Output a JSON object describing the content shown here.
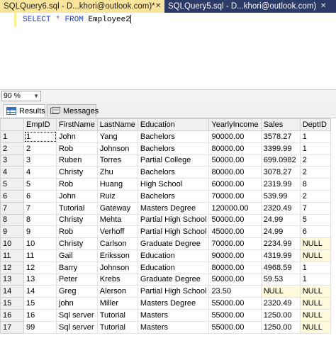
{
  "tabs": [
    {
      "title": "SQLQuery6.sql - D...khori@outlook.com)*",
      "close": "✕"
    },
    {
      "title": "SQLQuery5.sql - D...khori@outlook.com)",
      "close": "✕"
    }
  ],
  "editor": {
    "keyword_select": "SELECT",
    "star": "*",
    "keyword_from": "FROM",
    "table": "Employee2"
  },
  "zoom": {
    "value": "90 %"
  },
  "results_tabs": [
    {
      "label": "Results",
      "icon": "grid-icon"
    },
    {
      "label": "Messages",
      "icon": "messages-icon"
    }
  ],
  "grid": {
    "columns": [
      "EmpID",
      "FirstName",
      "LastName",
      "Education",
      "YearlyIncome",
      "Sales",
      "DeptID"
    ],
    "rows": [
      [
        "1",
        "1",
        "John",
        "Yang",
        "Bachelors",
        "90000.00",
        "3578.27",
        "1"
      ],
      [
        "2",
        "2",
        "Rob",
        "Johnson",
        "Bachelors",
        "80000.00",
        "3399.99",
        "1"
      ],
      [
        "3",
        "3",
        "Ruben",
        "Torres",
        "Partial College",
        "50000.00",
        "699.0982",
        "2"
      ],
      [
        "4",
        "4",
        "Christy",
        "Zhu",
        "Bachelors",
        "80000.00",
        "3078.27",
        "2"
      ],
      [
        "5",
        "5",
        "Rob",
        "Huang",
        "High School",
        "60000.00",
        "2319.99",
        "8"
      ],
      [
        "6",
        "6",
        "John",
        "Ruiz",
        "Bachelors",
        "70000.00",
        "539.99",
        "2"
      ],
      [
        "7",
        "7",
        "Tutorial",
        "Gateway",
        "Masters Degree",
        "120000.00",
        "2320.49",
        "7"
      ],
      [
        "8",
        "8",
        "Christy",
        "Mehta",
        "Partial High School",
        "50000.00",
        "24.99",
        "5"
      ],
      [
        "9",
        "9",
        "Rob",
        "Verhoff",
        "Partial High School",
        "45000.00",
        "24.99",
        "6"
      ],
      [
        "10",
        "10",
        "Christy",
        "Carlson",
        "Graduate Degree",
        "70000.00",
        "2234.99",
        "NULL"
      ],
      [
        "11",
        "11",
        "Gail",
        "Eriksson",
        "Education",
        "90000.00",
        "4319.99",
        "NULL"
      ],
      [
        "12",
        "12",
        "Barry",
        "Johnson",
        "Education",
        "80000.00",
        "4968.59",
        "1"
      ],
      [
        "13",
        "13",
        "Peter",
        "Krebs",
        "Graduate Degree",
        "50000.00",
        "59.53",
        "1"
      ],
      [
        "14",
        "14",
        "Greg",
        "Alerson",
        "Partial High School",
        "23.50",
        "NULL",
        "NULL"
      ],
      [
        "15",
        "15",
        "john",
        "Miller",
        "Masters Degree",
        "55000.00",
        "2320.49",
        "NULL"
      ],
      [
        "16",
        "16",
        "Sql server",
        "Tutorial",
        "Masters",
        "55000.00",
        "1250.00",
        "NULL"
      ],
      [
        "17",
        "99",
        "Sql server",
        "Tutorial",
        "Masters",
        "55000.00",
        "1250.00",
        "NULL"
      ]
    ]
  },
  "colors": {
    "active_tab": "#fbe59c",
    "tabbar": "#2b3a67",
    "keyword": "#1e40d0",
    "null_cell": "#fffbdc"
  }
}
